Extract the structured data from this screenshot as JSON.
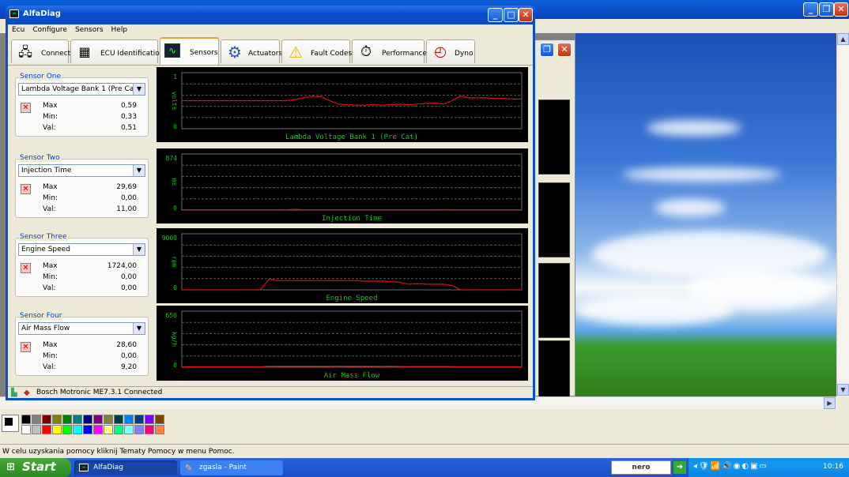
{
  "app": {
    "title": "AlfaDiag",
    "menu": [
      "Ecu",
      "Configure",
      "Sensors",
      "Help"
    ],
    "status": "Bosch Motronic ME7.3.1 Connected"
  },
  "tabs": [
    {
      "label": "Connect",
      "icon": "connect-icon",
      "selected": false
    },
    {
      "label": "ECU Identification",
      "icon": "chip-icon",
      "selected": false
    },
    {
      "label": "Sensors",
      "icon": "oscilloscope-icon",
      "selected": true
    },
    {
      "label": "Actuators",
      "icon": "gear-icon",
      "selected": false
    },
    {
      "label": "Fault Codes",
      "icon": "warning-icon",
      "selected": false
    },
    {
      "label": "Performance",
      "icon": "stopwatch-icon",
      "selected": false
    },
    {
      "label": "Dyno",
      "icon": "dial-icon",
      "selected": false
    }
  ],
  "stat_labels": {
    "max": "Max",
    "min": "Min:",
    "val": "Val:"
  },
  "sensors": [
    {
      "group": "Sensor One",
      "selected": "Lambda Voltage Bank 1 (Pre Cat)",
      "max": "0,59",
      "min": "0,33",
      "val": "0,51"
    },
    {
      "group": "Sensor Two",
      "selected": "Injection Time",
      "max": "29,69",
      "min": "0,00",
      "val": "11,00"
    },
    {
      "group": "Sensor Three",
      "selected": "Engine Speed",
      "max": "1724,00",
      "min": "0,00",
      "val": "0,00"
    },
    {
      "group": "Sensor Four",
      "selected": "Air Mass Flow",
      "max": "28,60",
      "min": "0,00",
      "val": "9,20"
    }
  ],
  "chart_data": [
    {
      "type": "line",
      "title": "Lambda Voltage Bank 1 (Pre Cat)",
      "ylabel": "volts",
      "ylim": [
        0,
        1
      ],
      "ytick_labels": [
        "1",
        "0"
      ],
      "series": [
        {
          "values": [
            0.5,
            0.5,
            0.5,
            0.5,
            0.5,
            0.5,
            0.5,
            0.5,
            0.5,
            0.5,
            0.5,
            0.5,
            0.5,
            0.52,
            0.55,
            0.58,
            0.57,
            0.5,
            0.44,
            0.43,
            0.42,
            0.42,
            0.43,
            0.42,
            0.43,
            0.44,
            0.43,
            0.44,
            0.45,
            0.46,
            0.44,
            0.5,
            0.58,
            0.55,
            0.55,
            0.55,
            0.54,
            0.54,
            0.53,
            0.53
          ]
        }
      ]
    },
    {
      "type": "line",
      "title": "Injection Time",
      "ylabel": "ms",
      "ylim": [
        0,
        874
      ],
      "ytick_labels": [
        "874",
        "0"
      ],
      "series": [
        {
          "values": [
            5,
            5,
            5,
            5,
            5,
            5,
            5,
            5,
            5,
            5,
            5,
            5,
            5,
            12,
            5,
            5,
            5,
            5,
            5,
            5,
            5,
            5,
            5,
            5,
            5,
            5,
            5,
            5,
            5,
            5,
            8,
            5,
            5,
            5,
            5,
            5,
            5,
            5,
            5,
            5
          ]
        }
      ]
    },
    {
      "type": "line",
      "title": "Engine Speed",
      "ylabel": "rpm",
      "ylim": [
        0,
        9000
      ],
      "ytick_labels": [
        "9000",
        "0"
      ],
      "series": [
        {
          "values": [
            0,
            0,
            0,
            0,
            0,
            0,
            0,
            0,
            0,
            0,
            1700,
            1500,
            1500,
            1500,
            1500,
            1500,
            1500,
            1500,
            1500,
            1500,
            1500,
            1400,
            1400,
            1400,
            1300,
            1200,
            900,
            1000,
            900,
            900,
            900,
            700,
            0,
            0,
            0,
            0,
            0,
            0,
            0,
            0
          ]
        }
      ]
    },
    {
      "type": "line",
      "title": "Air Mass Flow",
      "ylabel": "kg/h",
      "ylim": [
        0,
        650
      ],
      "ytick_labels": [
        "650",
        "0"
      ],
      "series": [
        {
          "values": [
            5,
            5,
            5,
            5,
            5,
            5,
            5,
            5,
            5,
            5,
            12,
            10,
            10,
            10,
            10,
            10,
            10,
            10,
            12,
            10,
            10,
            10,
            10,
            9,
            12,
            8,
            7,
            9,
            8,
            8,
            9,
            7,
            5,
            5,
            5,
            5,
            5,
            5,
            5,
            5
          ]
        }
      ]
    }
  ],
  "colors": {
    "line": "#e01010",
    "grid": "#5a5a5a",
    "label": "#20c020",
    "group_title": "#0046d5"
  },
  "paint": {
    "status": "W celu uzyskania pomocy kliknij Tematy Pomocy w menu Pomoc."
  },
  "taskbar": {
    "start": "Start",
    "tasks": [
      "AlfaDiag",
      "zgasla - Paint"
    ],
    "tray_logo": "nero",
    "clock": "10:16"
  }
}
